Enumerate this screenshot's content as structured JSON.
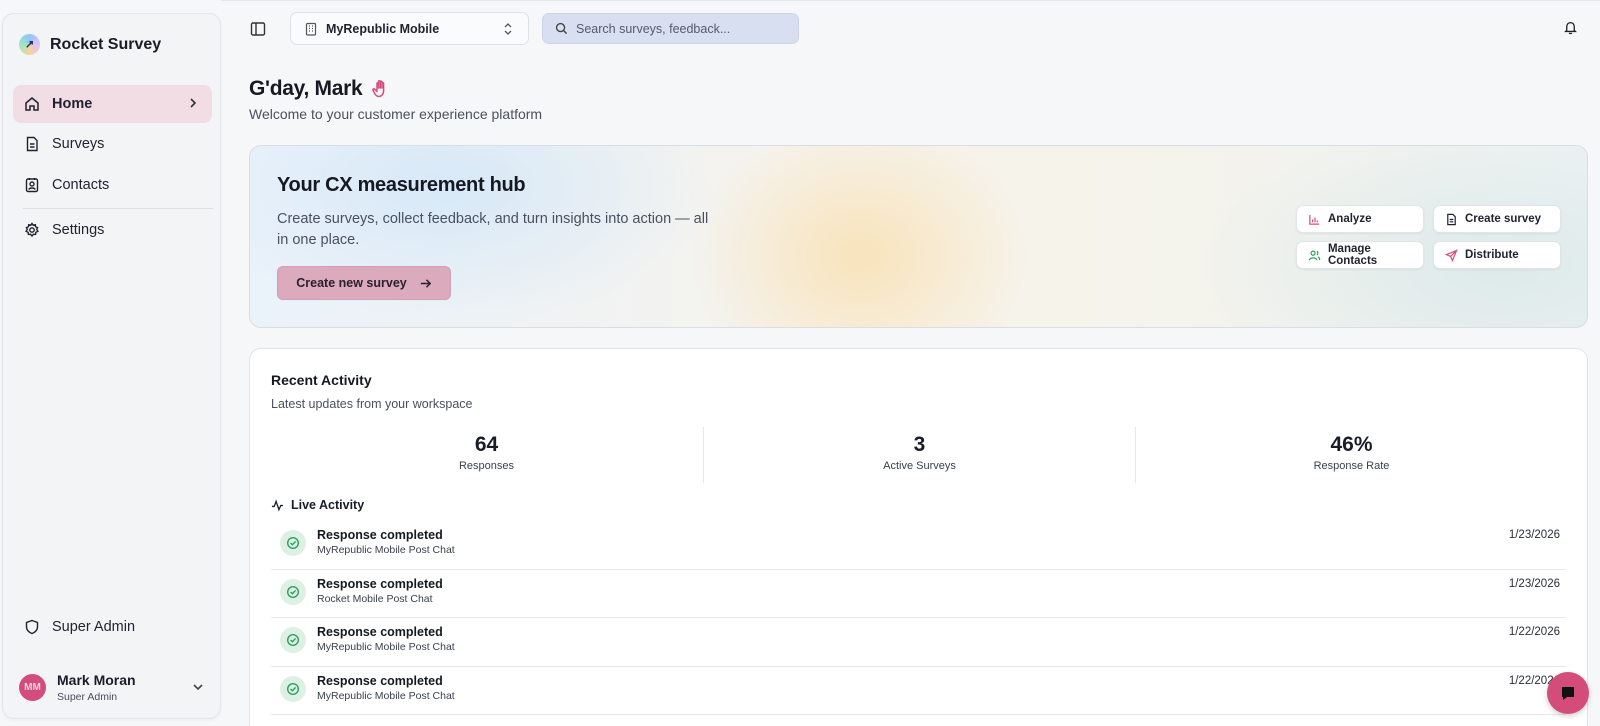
{
  "brand": {
    "name": "Rocket Survey"
  },
  "sidebar": {
    "items": [
      {
        "label": "Home",
        "icon": "home-icon",
        "active": true
      },
      {
        "label": "Surveys",
        "icon": "document-icon"
      },
      {
        "label": "Contacts",
        "icon": "contact-card-icon"
      },
      {
        "label": "Settings",
        "icon": "gear-icon"
      }
    ],
    "super_admin": {
      "label": "Super Admin",
      "icon": "shield-icon"
    },
    "user": {
      "initials": "MM",
      "name": "Mark Moran",
      "role": "Super Admin"
    }
  },
  "topbar": {
    "org": "MyRepublic Mobile",
    "search_placeholder": "Search surveys, feedback..."
  },
  "greeting": {
    "title": "G'day, Mark",
    "subtitle": "Welcome to your customer experience platform"
  },
  "hero": {
    "title": "Your CX measurement hub",
    "description": "Create surveys, collect feedback, and turn insights into action — all in one place.",
    "cta": "Create new survey",
    "quick_actions": {
      "analyze": "Analyze",
      "create_survey": "Create survey",
      "manage_contacts": "Manage Contacts",
      "distribute": "Distribute"
    }
  },
  "activity": {
    "title": "Recent Activity",
    "subtitle": "Latest updates from your workspace",
    "stats": [
      {
        "value": "64",
        "label": "Responses"
      },
      {
        "value": "3",
        "label": "Active Surveys"
      },
      {
        "value": "46%",
        "label": "Response Rate"
      }
    ],
    "live_title": "Live Activity",
    "live": [
      {
        "title": "Response completed",
        "desc": "MyRepublic Mobile Post Chat",
        "date": "1/23/2026"
      },
      {
        "title": "Response completed",
        "desc": "Rocket Mobile Post Chat",
        "date": "1/23/2026"
      },
      {
        "title": "Response completed",
        "desc": "MyRepublic Mobile Post Chat",
        "date": "1/22/2026"
      },
      {
        "title": "Response completed",
        "desc": "MyRepublic Mobile Post Chat",
        "date": "1/22/2026"
      }
    ]
  },
  "colors": {
    "accent": "#d44d7a",
    "active_nav_bg": "#f2dde4",
    "cta_bg": "#dbaabd",
    "success": "#2f9e5f"
  }
}
